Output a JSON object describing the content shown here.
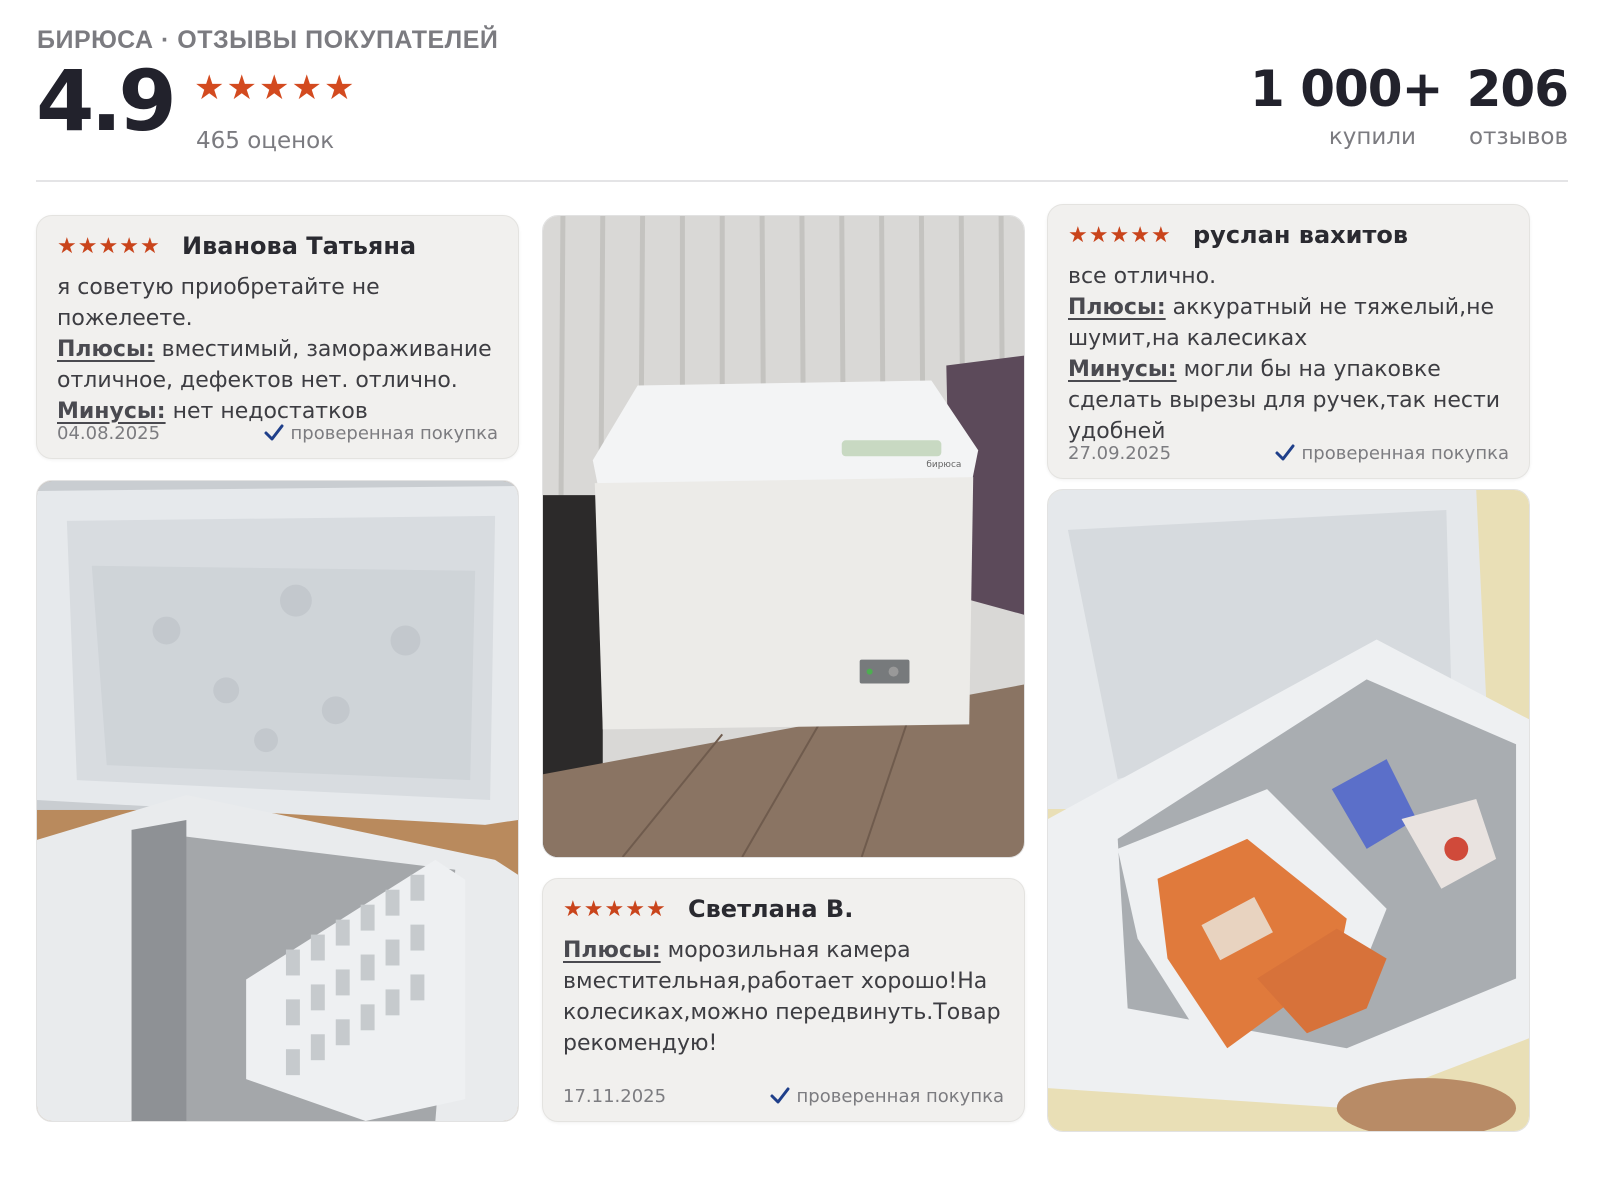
{
  "header": {
    "brand_caption": "БИРЮСА · ОТЗЫВЫ ПОКУПАТЕЛЕЙ",
    "rating": "4.9",
    "rating_stars": 5,
    "ratings_count": "465 оценок",
    "stats": {
      "bought_value": "1 000+",
      "bought_label": "купили",
      "reviews_value": "206",
      "reviews_label": "отзывов"
    }
  },
  "reviews": [
    {
      "stars": 5,
      "author": "Иванова Татьяна",
      "text": "я советую приобретайте не пожелеете.",
      "pros_label": "Плюсы:",
      "pros": "вместимый, замораживание отличное, дефектов нет. отлично.",
      "cons_label": "Минусы:",
      "cons": "нет недостатков",
      "date": "04.08.2025",
      "verified": "проверенная покупка"
    },
    {
      "stars": 5,
      "author": "Светлана В.",
      "pros_label": "Плюсы:",
      "pros": "морозильная камера вместительная,работает хорошо!На колесиках,можно передвинуть.Товар рекомендую!",
      "date": "17.11.2025",
      "verified": "проверенная покупка"
    },
    {
      "stars": 5,
      "author": "руслан вахитов",
      "text": "все отлично.",
      "pros_label": "Плюсы:",
      "pros": "аккуратный не тяжелый,не шумит,на калесиках",
      "cons_label": "Минусы:",
      "cons": "могли бы на упаковке сделать вырезы для ручек,так нести удобней",
      "date": "27.09.2025",
      "verified": "проверенная покупка"
    }
  ],
  "photos": [
    {
      "subject": "open chest freezer with white basket"
    },
    {
      "subject": "closed white chest freezer in room",
      "brand_mark": "бирюса"
    },
    {
      "subject": "open chest freezer filled with food"
    }
  ],
  "colors": {
    "star": "#c9441b",
    "check": "#1f3f8a",
    "card_bg": "#f1f0ee"
  },
  "icons": {
    "star": "star-icon",
    "verified": "check-icon"
  }
}
